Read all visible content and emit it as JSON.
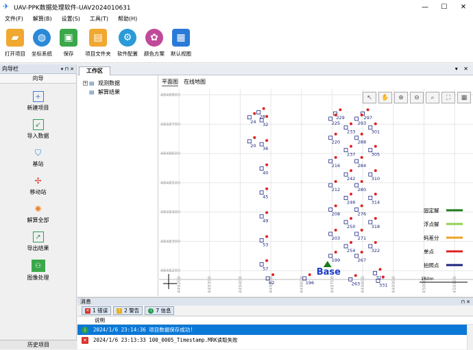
{
  "window": {
    "title": "UAV-PPK数据处理软件-UAV2024010631"
  },
  "menu": [
    "文件(F)",
    "解算(B)",
    "设置(S)",
    "工具(T)",
    "帮助(H)"
  ],
  "toolbar": [
    {
      "label": "打开项目",
      "icon": "folder-open-icon",
      "color": "#f0a830"
    },
    {
      "label": "坐标系统",
      "icon": "globe-icon",
      "color": "#2a8ad8"
    },
    {
      "label": "保存",
      "icon": "save-icon",
      "color": "#3aa84a"
    },
    {
      "label": "项目文件夹",
      "icon": "project-folder-icon",
      "color": "#f0a830"
    },
    {
      "label": "软件配置",
      "icon": "settings-icon",
      "color": "#2a9ad8"
    },
    {
      "label": "颜色方案",
      "icon": "palette-icon",
      "color": "#c04a9a"
    },
    {
      "label": "默认视图",
      "icon": "default-view-icon",
      "color": "#2a7ad8"
    }
  ],
  "navigator": {
    "title": "向导栏",
    "header": "向导",
    "items": [
      {
        "label": "新建项目",
        "icon": "new-project-icon"
      },
      {
        "label": "导入数据",
        "icon": "import-data-icon"
      },
      {
        "label": "基站",
        "icon": "base-station-icon"
      },
      {
        "label": "移动站",
        "icon": "rover-icon"
      },
      {
        "label": "解算全部",
        "icon": "solve-all-icon"
      },
      {
        "label": "导出结果",
        "icon": "export-icon"
      },
      {
        "label": "图像处理",
        "icon": "image-process-icon"
      }
    ],
    "footer": "历史项目"
  },
  "workspace": {
    "tab": "工作区",
    "tree": [
      {
        "label": "观测数据",
        "icon": "observation-data-icon",
        "expander": "+"
      },
      {
        "label": "解算结果",
        "icon": "solution-result-icon",
        "expander": ""
      }
    ],
    "view_tabs": [
      "平面图",
      "在线地图"
    ],
    "scale_label": "160m"
  },
  "chart_data": {
    "type": "scatter",
    "y_ticks": [
      "4848800",
      "4848700",
      "4848600",
      "4848500",
      "4848400",
      "4848300",
      "4848200"
    ],
    "x_ticks": [
      "449200",
      "449300",
      "449400",
      "449500",
      "449600",
      "449700",
      "449800",
      "449900",
      "450000",
      "450100"
    ],
    "xlim": [
      449135,
      450160
    ],
    "ylim": [
      4848170,
      4848820
    ],
    "legend": [
      {
        "name": "固定解",
        "color": "#1a7a1a"
      },
      {
        "name": "浮点解",
        "color": "#8fd14f"
      },
      {
        "name": "码差分",
        "color": "#f0a020"
      },
      {
        "name": "单点",
        "color": "#e02020"
      },
      {
        "name": "拍照点",
        "color": "#1a237e"
      }
    ],
    "base": {
      "label": "Base",
      "x": 449685,
      "y": 4848198
    },
    "labels": [
      {
        "t": "28",
        "x": 449470,
        "y": 4848737
      },
      {
        "t": "24",
        "x": 449440,
        "y": 4848720
      },
      {
        "t": "32",
        "x": 449480,
        "y": 4848710
      },
      {
        "t": "20",
        "x": 449440,
        "y": 4848638
      },
      {
        "t": "36",
        "x": 449480,
        "y": 4848628
      },
      {
        "t": "40",
        "x": 449480,
        "y": 4848545
      },
      {
        "t": "45",
        "x": 449480,
        "y": 4848463
      },
      {
        "t": "49",
        "x": 449480,
        "y": 4848382
      },
      {
        "t": "53",
        "x": 449480,
        "y": 4848300
      },
      {
        "t": "57",
        "x": 449480,
        "y": 4848218
      },
      {
        "t": "62",
        "x": 449500,
        "y": 4848170
      },
      {
        "t": "196",
        "x": 449620,
        "y": 4848170
      },
      {
        "t": "229",
        "x": 449720,
        "y": 4848733
      },
      {
        "t": "225",
        "x": 449705,
        "y": 4848715
      },
      {
        "t": "297",
        "x": 449810,
        "y": 4848733
      },
      {
        "t": "293",
        "x": 449790,
        "y": 4848715
      },
      {
        "t": "233",
        "x": 449755,
        "y": 4848685
      },
      {
        "t": "301",
        "x": 449835,
        "y": 4848685
      },
      {
        "t": "220",
        "x": 449705,
        "y": 4848650
      },
      {
        "t": "288",
        "x": 449790,
        "y": 4848650
      },
      {
        "t": "237",
        "x": 449755,
        "y": 4848608
      },
      {
        "t": "305",
        "x": 449835,
        "y": 4848608
      },
      {
        "t": "216",
        "x": 449705,
        "y": 4848570
      },
      {
        "t": "284",
        "x": 449790,
        "y": 4848570
      },
      {
        "t": "242",
        "x": 449755,
        "y": 4848525
      },
      {
        "t": "310",
        "x": 449835,
        "y": 4848525
      },
      {
        "t": "212",
        "x": 449705,
        "y": 4848488
      },
      {
        "t": "280",
        "x": 449790,
        "y": 4848488
      },
      {
        "t": "246",
        "x": 449755,
        "y": 4848445
      },
      {
        "t": "314",
        "x": 449835,
        "y": 4848445
      },
      {
        "t": "208",
        "x": 449705,
        "y": 4848405
      },
      {
        "t": "276",
        "x": 449790,
        "y": 4848405
      },
      {
        "t": "250",
        "x": 449755,
        "y": 4848362
      },
      {
        "t": "318",
        "x": 449835,
        "y": 4848362
      },
      {
        "t": "203",
        "x": 449705,
        "y": 4848322
      },
      {
        "t": "271",
        "x": 449790,
        "y": 4848322
      },
      {
        "t": "254",
        "x": 449755,
        "y": 4848280
      },
      {
        "t": "322",
        "x": 449835,
        "y": 4848280
      },
      {
        "t": "199",
        "x": 449705,
        "y": 4848247
      },
      {
        "t": "267",
        "x": 449790,
        "y": 4848247
      },
      {
        "t": "263",
        "x": 449770,
        "y": 4848167
      },
      {
        "t": "327",
        "x": 449850,
        "y": 4848188
      },
      {
        "t": "331",
        "x": 449860,
        "y": 4848162
      }
    ]
  },
  "messages": {
    "title": "消息",
    "filters": [
      {
        "label": "1 错误",
        "icon": "error-icon",
        "color": "#d9342b"
      },
      {
        "label": "2 警告",
        "icon": "warning-icon",
        "color": "#e8b020"
      },
      {
        "label": "7 信息",
        "icon": "info-icon",
        "color": "#2e9b4f"
      }
    ],
    "column": "说明",
    "rows": [
      {
        "text": "2024/1/6 23:14:36  项目数据保存成功!",
        "type": "info",
        "color": "#2e9b4f",
        "icon": "info-icon"
      },
      {
        "text": "2024/1/6 23:13:33  100_0005_Timestamp.MRK读取失败",
        "type": "error",
        "color": "#d9342b",
        "icon": "error-icon"
      }
    ]
  }
}
